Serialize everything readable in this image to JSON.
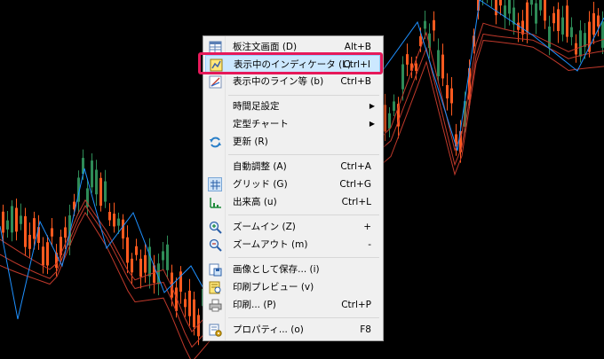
{
  "menu": {
    "items": [
      {
        "label": "板注文画面 (D)",
        "shortcut": "Alt+B",
        "icon": "order-board-icon"
      },
      {
        "label": "表示中のインディケータ (L)",
        "shortcut": "Ctrl+I",
        "icon": "indicator-list-icon"
      },
      {
        "label": "表示中のライン等 (b)",
        "shortcut": "Ctrl+B",
        "icon": "line-objects-icon"
      },
      {
        "label": "時間足設定",
        "shortcut": "",
        "icon": "",
        "submenu": true
      },
      {
        "label": "定型チャート",
        "shortcut": "",
        "icon": "",
        "submenu": true
      },
      {
        "label": "更新 (R)",
        "shortcut": "",
        "icon": "refresh-icon"
      },
      {
        "label": "自動調整 (A)",
        "shortcut": "Ctrl+A",
        "icon": ""
      },
      {
        "label": "グリッド (G)",
        "shortcut": "Ctrl+G",
        "icon": "grid-icon"
      },
      {
        "label": "出来高 (u)",
        "shortcut": "Ctrl+L",
        "icon": "volume-icon"
      },
      {
        "label": "ズームイン (Z)",
        "shortcut": "+",
        "icon": "zoom-in-icon"
      },
      {
        "label": "ズームアウト (m)",
        "shortcut": "-",
        "icon": "zoom-out-icon"
      },
      {
        "label": "画像として保存... (i)",
        "shortcut": "",
        "icon": "save-image-icon"
      },
      {
        "label": "印刷プレビュー (v)",
        "shortcut": "",
        "icon": "print-preview-icon"
      },
      {
        "label": "印刷... (P)",
        "shortcut": "Ctrl+P",
        "icon": "print-icon"
      },
      {
        "label": "プロパティ... (o)",
        "shortcut": "F8",
        "icon": "properties-icon"
      }
    ],
    "highlighted_index": 1
  },
  "colors": {
    "background": "#000000",
    "bull_candle": "#2e8b57",
    "bear_candle": "#ff5a1f",
    "zigzag": "#1e90ff",
    "moving_average": "#c0392b",
    "menu_highlight": "#cce8ff",
    "annotation_frame": "#e6195a"
  }
}
